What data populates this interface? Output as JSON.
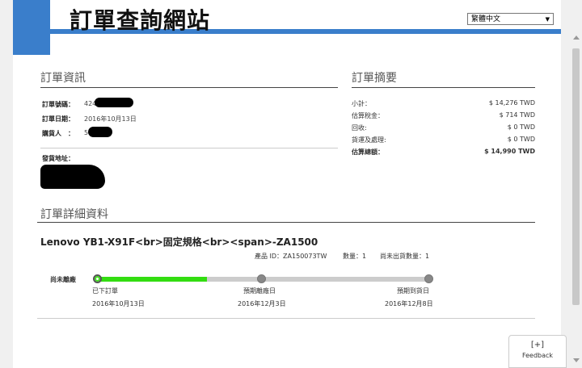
{
  "header": {
    "title": "訂單查詢網站",
    "language": "繁體中文"
  },
  "order_info": {
    "section_title": "訂單資訊",
    "rows": [
      {
        "label": "訂單號碼：",
        "value": "424"
      },
      {
        "label": "訂單日期：",
        "value": "2016年10月13日"
      },
      {
        "label": "購貨人　：",
        "value": "5"
      }
    ],
    "address_label": "發貨地址："
  },
  "order_summary": {
    "section_title": "訂單摘要",
    "rows": [
      {
        "label": "小計：",
        "value": "$ 14,276 TWD"
      },
      {
        "label": "估算稅金：",
        "value": "$ 714 TWD"
      },
      {
        "label": "回收:",
        "value": "$ 0 TWD"
      },
      {
        "label": "貨運及處理:",
        "value": "$ 0 TWD"
      },
      {
        "label": "估算總額：",
        "value": "$ 14,990 TWD"
      }
    ]
  },
  "order_detail": {
    "section_title": "訂單詳細資料",
    "product_name": "Lenovo YB1-X91F<br>固定規格<br><span>-ZA1500",
    "product_id": "產品 ID：ZA150073TW",
    "quantity": "數量：1",
    "unshipped": "尚未出貨數量：1",
    "tracking_label": "尚未離廠",
    "progress": 0.33,
    "steps": [
      {
        "label": "已下訂單",
        "date": "2016年10月13日"
      },
      {
        "label": "預期離廠日",
        "date": "2016年12月3日"
      },
      {
        "label": "預期到貨日",
        "date": "2016年12月8日"
      }
    ]
  },
  "feedback": {
    "icon_text": "[+]",
    "label": "Feedback"
  },
  "colors": {
    "brand_blue": "#3a7ecb",
    "progress_green": "#33dd11"
  }
}
